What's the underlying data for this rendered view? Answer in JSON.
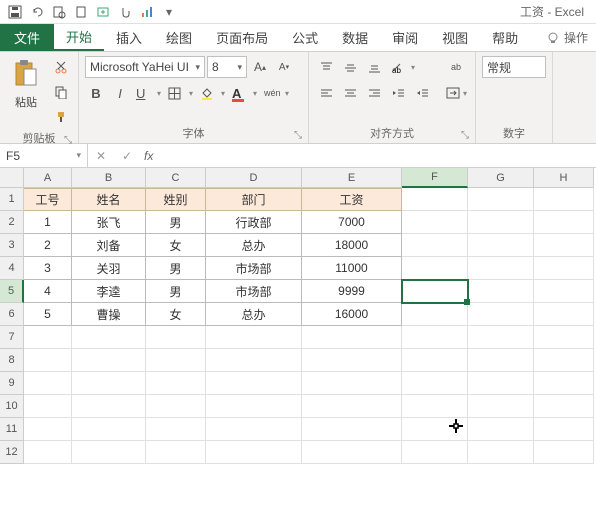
{
  "app": {
    "title": "工资 - Excel"
  },
  "tabs": {
    "file": "文件",
    "items": [
      "开始",
      "插入",
      "绘图",
      "页面布局",
      "公式",
      "数据",
      "审阅",
      "视图",
      "帮助"
    ],
    "activeIndex": 0,
    "tell": "操作"
  },
  "ribbon": {
    "clipboard": {
      "paste": "粘贴",
      "label": "剪贴板"
    },
    "font": {
      "name": "Microsoft YaHei UI",
      "size": "8",
      "label": "字体"
    },
    "align": {
      "wrap": "ab",
      "label": "对齐方式"
    },
    "number": {
      "format": "常规",
      "label": "数字"
    }
  },
  "namebox": "F5",
  "columns": [
    "A",
    "B",
    "C",
    "D",
    "E",
    "F",
    "G",
    "H"
  ],
  "rowcount": 12,
  "selectedRow": 5,
  "selectedCol": "F",
  "table": {
    "headers": [
      "工号",
      "姓名",
      "姓别",
      "部门",
      "工资"
    ],
    "rows": [
      [
        "1",
        "张飞",
        "男",
        "行政部",
        "7000"
      ],
      [
        "2",
        "刘备",
        "女",
        "总办",
        "18000"
      ],
      [
        "3",
        "关羽",
        "男",
        "市场部",
        "11000"
      ],
      [
        "4",
        "李逵",
        "男",
        "市场部",
        "9999"
      ],
      [
        "5",
        "曹操",
        "女",
        "总办",
        "16000"
      ]
    ]
  }
}
